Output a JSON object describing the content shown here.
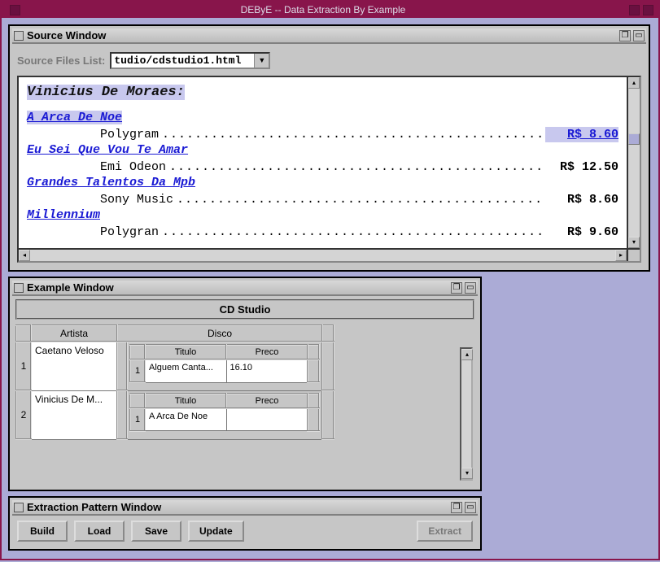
{
  "app_title": "DEByE -- Data Extraction By Example",
  "source_window": {
    "title": "Source Window",
    "files_label": "Source Files List:",
    "selected_file": "tudio/cdstudio1.html",
    "artist_heading": "Vinicius De Moraes:",
    "rows": [
      {
        "album": "A Arca De Noe",
        "album_selected": true,
        "label": "Polygram",
        "price": "R$  8.60",
        "price_selected": true
      },
      {
        "album": "Eu Sei Que Vou Te Amar",
        "album_selected": false,
        "label": "Emi Odeon",
        "price": "R$  12.50",
        "price_selected": false
      },
      {
        "album": "Grandes Talentos Da Mpb",
        "album_selected": false,
        "label": "Sony Music",
        "price": "R$  8.60",
        "price_selected": false
      },
      {
        "album": "Millennium",
        "album_selected": false,
        "label": "Polygran",
        "price": "R$  9.60",
        "price_selected": false
      }
    ]
  },
  "example_window": {
    "title": "Example Window",
    "subtitle": "CD Studio",
    "col_artista": "Artista",
    "col_disco": "Disco",
    "col_titulo": "Titulo",
    "col_preco": "Preco",
    "rows": [
      {
        "n": "1",
        "artista": "Caetano Veloso",
        "disco": [
          {
            "n": "1",
            "titulo": "Alguem Canta...",
            "preco": "16.10"
          }
        ]
      },
      {
        "n": "2",
        "artista": "Vinicius De M...",
        "disco": [
          {
            "n": "1",
            "titulo": "A Arca De Noe",
            "preco": ""
          }
        ]
      }
    ]
  },
  "extraction_window": {
    "title": "Extraction Pattern Window",
    "buttons": {
      "build": "Build",
      "load": "Load",
      "save": "Save",
      "update": "Update",
      "extract": "Extract"
    }
  }
}
